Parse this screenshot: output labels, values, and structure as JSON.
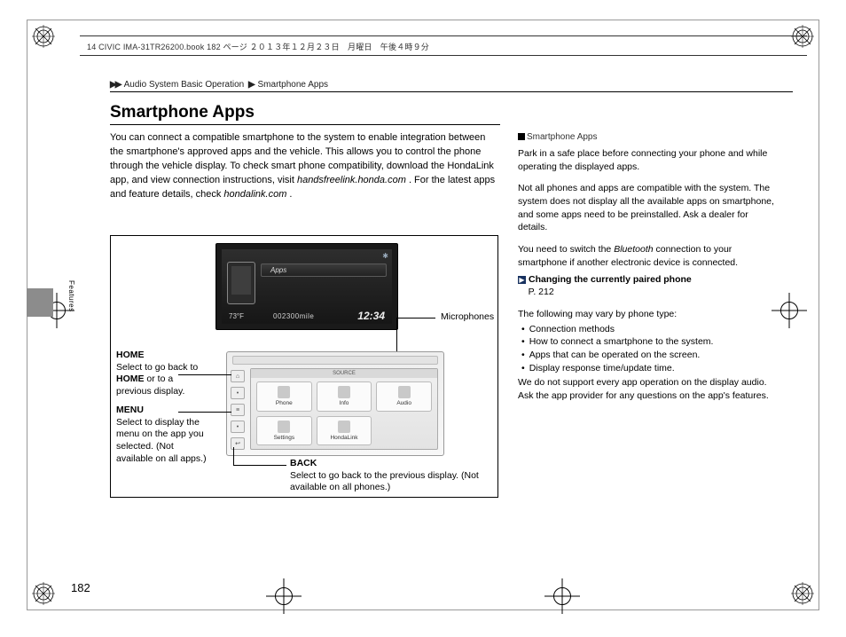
{
  "header": {
    "file_info": "14 CIVIC IMA-31TR26200.book  182 ページ  ２０１３年１２月２３日　月曜日　午後４時９分"
  },
  "breadcrumb": {
    "sep": "▶▶",
    "a": "Audio System Basic Operation",
    "b": "Smartphone Apps"
  },
  "title": "Smartphone Apps",
  "intro": {
    "p1a": "You can connect a compatible smartphone to the system to enable integration between the smartphone's approved apps and the vehicle. This allows you to control the phone through the vehicle display. To check smart phone compatibility, download the HondaLink app, and view connection instructions, visit ",
    "p1b": "handsfreelink.honda.com",
    "p1c": ". For the latest apps and feature details, check ",
    "p1d": "hondalink.com",
    "p1e": "."
  },
  "upper_display": {
    "apps_label": "Apps",
    "temp": "73°F",
    "odo": "002300mile",
    "clock": "12:34",
    "bt": "✱"
  },
  "touch_header": "SOURCE",
  "apps": {
    "a1": "Phone",
    "a2": "Info",
    "a3": "Audio",
    "a4": "Settings",
    "a5": "HondaLink"
  },
  "callouts": {
    "mic": "Microphones",
    "home_t": "HOME",
    "home_b": "Select to go back to ",
    "home_b2": "HOME",
    "home_b3": " or to a previous display.",
    "menu_t": "MENU",
    "menu_b": "Select to display the menu on the app you selected. (Not available on all apps.)",
    "back_t": "BACK",
    "back_b": "Select to go back to the previous display. (Not available on all phones.)"
  },
  "side": {
    "hd": "Smartphone Apps",
    "p1": "Park in a safe place before connecting your phone and while operating the displayed apps.",
    "p2": "Not all phones and apps are compatible with the system. The system does not display all the available apps on smartphone, and some apps need to be preinstalled. Ask a dealer for details.",
    "p3a": "You need to switch the ",
    "p3b": "Bluetooth",
    "p3c": " connection to your smartphone if another electronic device is connected.",
    "ref_t": "Changing the currently paired phone",
    "ref_p": "P. 212",
    "p4": "The following may vary by phone type:",
    "b1": "Connection methods",
    "b2": "How to connect a smartphone to the system.",
    "b3": "Apps that can be operated on the screen.",
    "b4": "Display response time/update time.",
    "p5": "We do not support every app operation on the display audio.",
    "p6": "Ask the app provider for any questions on the app's features."
  },
  "side_label": "Features",
  "page_number": "182"
}
